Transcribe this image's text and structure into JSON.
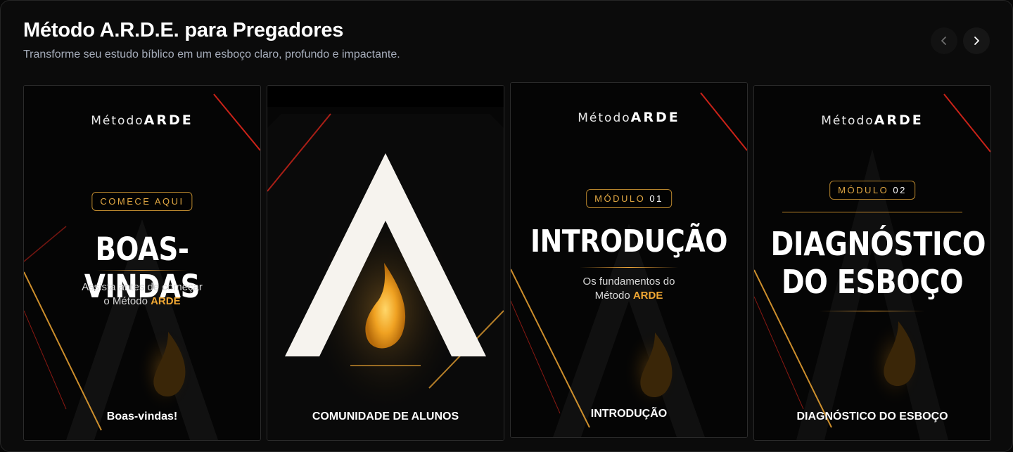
{
  "header": {
    "title": "Método A.R.D.E. para Pregadores",
    "subtitle": "Transforme seu estudo bíblico em um esboço claro, profundo e impactante."
  },
  "nav": {
    "prev_icon": "chevron-left-icon",
    "next_icon": "chevron-right-icon"
  },
  "brand": {
    "prefix": "Método",
    "name": "ARDE"
  },
  "colors": {
    "accent": "#f0a733",
    "background": "#0b0b0b",
    "red_glow": "#e0261b"
  },
  "cards": [
    {
      "badge": "COMECE AQUI",
      "title": "BOAS-VINDAS",
      "desc_line1": "Assista antes de começar",
      "desc_line2_prefix": "o Método",
      "desc_line2_accent": "ARDE",
      "label": "Boas-vindas!"
    },
    {
      "label": "COMUNIDADE DE ALUNOS"
    },
    {
      "badge_prefix": "MÓDULO",
      "badge_num": "01",
      "title": "INTRODUÇÃO",
      "desc_line1": "Os fundamentos do",
      "desc_line2_prefix": "Método",
      "desc_line2_accent": "ARDE",
      "label": "INTRODUÇÃO"
    },
    {
      "badge_prefix": "MÓDULO",
      "badge_num": "02",
      "title_line1": "DIAGNÓSTICO",
      "title_line2": "DO ESBOÇO",
      "label": "DIAGNÓSTICO DO ESBOÇO"
    }
  ]
}
